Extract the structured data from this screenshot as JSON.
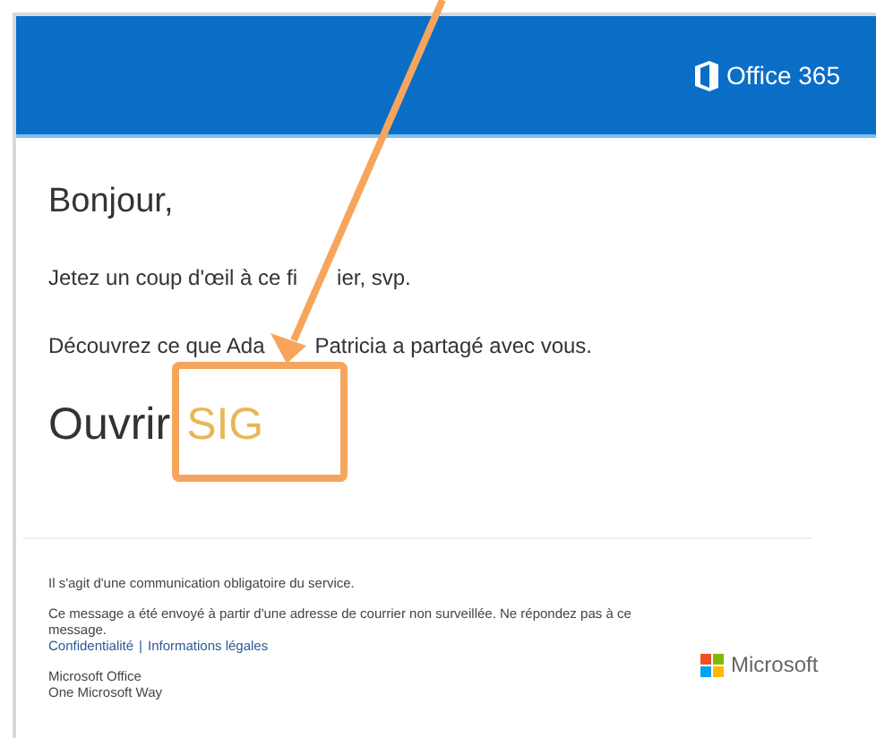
{
  "header": {
    "product": "Office 365"
  },
  "greeting": "Bonjour,",
  "paragraphs": [
    [
      "Jetez un coup d'œil à ce fi",
      "ier, svp."
    ],
    [
      "Découvrez ce que Ada",
      "Patricia a partagé avec vous."
    ]
  ],
  "open_link": {
    "label": "Ouvrir",
    "file": "SIG"
  },
  "footer": {
    "notice": "Il s'agit d'une communication obligatoire du service.",
    "message": "Ce message a été envoyé à partir d'une adresse de courrier non surveillée. Ne répondez pas à ce message.",
    "links": [
      "Confidentialité",
      "Informations légales"
    ],
    "separator": "|",
    "address": [
      "Microsoft Office",
      "One Microsoft Way"
    ],
    "brand": "Microsoft"
  }
}
